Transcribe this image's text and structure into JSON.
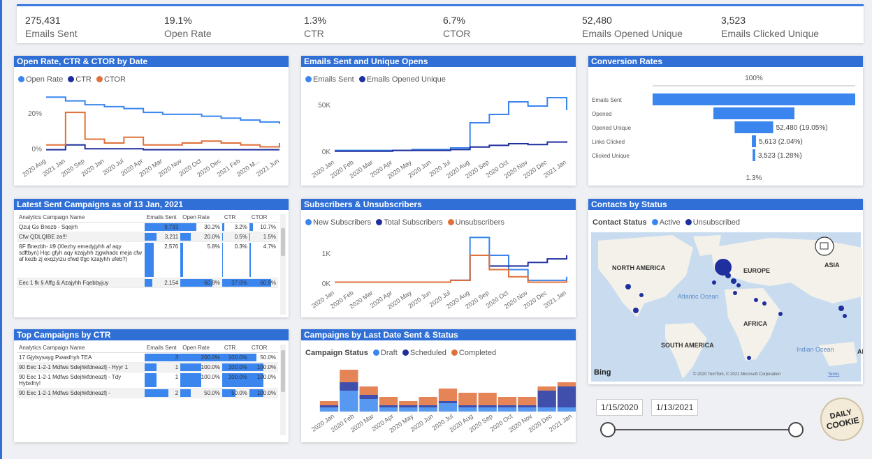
{
  "kpis": [
    {
      "value": "275,431",
      "label": "Emails Sent"
    },
    {
      "value": "19.1%",
      "label": "Open Rate"
    },
    {
      "value": "1.3%",
      "label": "CTR"
    },
    {
      "value": "6.7%",
      "label": "CTOR"
    },
    {
      "value": "52,480",
      "label": "Emails Opened Unique"
    },
    {
      "value": "3,523",
      "label": "Emails Clicked Unique"
    }
  ],
  "colors": {
    "accent": "#2f6fd6",
    "light_blue": "#3a86ee",
    "dark_blue": "#1f2f9e",
    "orange": "#e0703a"
  },
  "chart_data": [
    {
      "type": "line",
      "title": "Open Rate, CTR & CTOR by Date",
      "categories": [
        "2020 Aug",
        "2021 Jan",
        "2020 Sep",
        "2020 Jan",
        "2020 Jul",
        "2020 Apr",
        "2020 Mar",
        "2020 Nov",
        "2020 Oct",
        "2020 Dec",
        "2021 Feb",
        "2020 M...",
        "2021 Jun"
      ],
      "yticks": [
        "20%",
        "0%"
      ],
      "series": [
        {
          "name": "Open Rate",
          "values": [
            28,
            26,
            24,
            23,
            22,
            20,
            19,
            19,
            18,
            17,
            16,
            15,
            14
          ]
        },
        {
          "name": "CTR",
          "values": [
            0.5,
            3,
            1,
            1,
            1,
            0.5,
            0.5,
            0.5,
            0.5,
            0.5,
            0.5,
            0.5,
            0.5
          ]
        },
        {
          "name": "CTOR",
          "values": [
            3,
            20,
            6,
            4,
            7,
            3,
            3,
            4,
            5,
            4,
            3,
            2,
            4
          ]
        }
      ],
      "ylim": [
        0,
        35
      ]
    },
    {
      "type": "line",
      "title": "Emails Sent and Unique Opens",
      "categories": [
        "2020 Jan",
        "2020 Feb",
        "2020 Mar",
        "2020 Apr",
        "2020 May",
        "2020 Jun",
        "2020 Jul",
        "2020 Aug",
        "2020 Sep",
        "2020 Oct",
        "2020 Nov",
        "2020 Dec",
        "2021 Jan"
      ],
      "yticks": [
        "50K",
        "0K"
      ],
      "series": [
        {
          "name": "Emails Sent",
          "values": [
            2,
            2,
            2,
            2,
            3,
            3,
            5,
            35,
            45,
            60,
            55,
            65,
            50
          ]
        },
        {
          "name": "Emails Opened Unique",
          "values": [
            1,
            1,
            1,
            2,
            2,
            2,
            3,
            6,
            8,
            10,
            9,
            12,
            13
          ]
        }
      ],
      "ylim": [
        0,
        75
      ]
    },
    {
      "type": "bar",
      "title": "Conversion Rates",
      "categories": [
        "Emails Sent",
        "Opened",
        "Opened Unique",
        "Links Clicked",
        "Clicked Unique"
      ],
      "values": [
        100,
        40,
        19.05,
        2.04,
        1.28
      ],
      "labels": [
        "",
        "",
        "52,480 (19.05%)",
        "5,613 (2.04%)",
        "3,523 (1.28%)"
      ],
      "top_label": "100%",
      "bottom_label": "1.3%"
    },
    {
      "type": "line",
      "title": "Subscribers & Unsubscribers",
      "categories": [
        "2020 Jan",
        "2020 Feb",
        "2020 Mar",
        "2020 Apr",
        "2020 May",
        "2020 Jun",
        "2020 Jul",
        "2020 Aug",
        "2020 Sep",
        "2020 Oct",
        "2020 Nov",
        "2020 Dec",
        "2021 Jan"
      ],
      "yticks": [
        "1K",
        "0K"
      ],
      "series": [
        {
          "name": "New Subscribers",
          "values": [
            0.05,
            0.05,
            0.05,
            0.05,
            0.05,
            0.05,
            0.1,
            1.3,
            0.8,
            0.4,
            0.1,
            0.1,
            0.2
          ]
        },
        {
          "name": "Total Subscribers",
          "values": [
            0.05,
            0.05,
            0.05,
            0.05,
            0.05,
            0.05,
            0.1,
            0.8,
            0.5,
            0.5,
            0.6,
            0.7,
            0.8
          ]
        },
        {
          "name": "Unsubscribers",
          "values": [
            0.05,
            0.05,
            0.05,
            0.05,
            0.05,
            0.05,
            0.1,
            0.8,
            0.4,
            0.2,
            0.05,
            0.05,
            0.1
          ]
        }
      ],
      "ylim": [
        0,
        1.6
      ]
    },
    {
      "type": "area",
      "title": "Campaigns by Last Date Sent & Status",
      "categories": [
        "2020 Jan",
        "2020 Feb",
        "2020 Mar",
        "2020 Apr",
        "2020 May",
        "2020 Jun",
        "2020 Jul",
        "2020 Aug",
        "2020 Sep",
        "2020 Oct",
        "2020 Nov",
        "2020 Dec",
        "2021 Jan"
      ],
      "series": [
        {
          "name": "Draft",
          "values": [
            1,
            5,
            3,
            1,
            1,
            1,
            2,
            1,
            1,
            1,
            1,
            1,
            1
          ]
        },
        {
          "name": "Scheduled",
          "values": [
            0.5,
            2,
            1,
            0.5,
            0.5,
            0.5,
            0.5,
            0.5,
            0.5,
            0.5,
            0.5,
            4,
            5
          ]
        },
        {
          "name": "Completed",
          "values": [
            1,
            3,
            2,
            2,
            1,
            2,
            3,
            3,
            3,
            2,
            2,
            1,
            1
          ]
        }
      ]
    }
  ],
  "cards": {
    "open_rate": {
      "title": "Open Rate, CTR & CTOR by Date",
      "legend": [
        "Open Rate",
        "CTR",
        "CTOR"
      ]
    },
    "emails_sent": {
      "title": "Emails Sent and Unique Opens",
      "legend": [
        "Emails Sent",
        "Emails Opened Unique"
      ]
    },
    "conversion": {
      "title": "Conversion Rates"
    },
    "subscribers": {
      "title": "Subscribers & Unsubscribers",
      "legend": [
        "New Subscribers",
        "Total Subscribers",
        "Unsubscribers"
      ]
    },
    "campaigns_status": {
      "title": "Campaigns by Last Date Sent & Status",
      "legend_title": "Campaign Status",
      "legend": [
        "Draft",
        "Scheduled",
        "Completed"
      ]
    },
    "contacts": {
      "title": "Contacts by Status",
      "legend_title": "Contact Status",
      "legend": [
        "Active",
        "Unsubscribed"
      ]
    }
  },
  "latest_campaigns": {
    "title": "Latest Sent Campaigns as of 13 Jan, 2021",
    "columns": [
      "Analytics Campaign Name",
      "Emails Sent",
      "Open Rate",
      "CTR",
      "CTOR"
    ],
    "rows": [
      {
        "name": "Qzuj Gs Bnezb - Sqejrh",
        "sent": "9,733",
        "open": "30.2%",
        "ctr": "3.2%",
        "ctor": "10.7%",
        "sent_pct": 100,
        "open_pct": 38,
        "ctr_pct": 9,
        "ctor_pct": 12
      },
      {
        "name": "Cfw QDLQIBE za!!!",
        "sent": "3,211",
        "open": "20.0%",
        "ctr": "0.5%",
        "ctor": "1.5%",
        "sent_pct": 33,
        "open_pct": 25,
        "ctr_pct": 1,
        "ctor_pct": 2
      },
      {
        "name": "ßF Bnezbh- #9 (Xlezhy emedyjyhh af aqy sdftbyn) Hqc gfyh aqy kzajyhh zjgwhadc meja cfw af kezb zj exqzyizu cfwd tfgc kzajyhh ufeb?)",
        "sent": "2,576",
        "open": "5.8%",
        "ctr": "0.3%",
        "ctor": "4.7%",
        "sent_pct": 26,
        "open_pct": 7,
        "ctr_pct": 1,
        "ctor_pct": 6
      },
      {
        "name": "Eec 1 fk § Affg & Azajyhh Fqebbyjuy",
        "sent": "2,154",
        "open": "60.8%",
        "ctr": "37.0%",
        "ctor": "60.9%",
        "sent_pct": 22,
        "open_pct": 76,
        "ctr_pct": 100,
        "ctor_pct": 76
      }
    ]
  },
  "top_campaigns": {
    "title": "Top Campaigns by CTR",
    "columns": [
      "Analytics Campaign Name",
      "Emails Sent",
      "Open Rate",
      "CTR",
      "CTOR"
    ],
    "rows": [
      {
        "name": "17 Gjylsysayg Pwasfnyh TEA",
        "sent": "3",
        "open": "200.0%",
        "ctr": "100.0%",
        "ctor": "50.0%",
        "sent_pct": 100,
        "open_pct": 100,
        "ctr_pct": 100,
        "ctor_pct": 25
      },
      {
        "name": "90 Eec 1-2-1 Mdfws Sdejhkfdneazfj - Hyyr 1",
        "sent": "1",
        "open": "100.0%",
        "ctr": "100.0%",
        "ctor": "100.0%",
        "sent_pct": 33,
        "open_pct": 50,
        "ctr_pct": 100,
        "ctor_pct": 50
      },
      {
        "name": "90 Eec 1-2-1 Mdfws Sdejhkfdneazfj - Tdy Hybxfny!",
        "sent": "1",
        "open": "100.0%",
        "ctr": "100.0%",
        "ctor": "100.0%",
        "sent_pct": 33,
        "open_pct": 50,
        "ctr_pct": 100,
        "ctor_pct": 50
      },
      {
        "name": "90 Eec 1-2-1 Mdfws Sdejhkfdneazfj -",
        "sent": "2",
        "open": "50.0%",
        "ctr": "50.0%",
        "ctor": "100.0%",
        "sent_pct": 66,
        "open_pct": 25,
        "ctr_pct": 50,
        "ctor_pct": 50
      }
    ]
  },
  "map": {
    "labels": [
      "NORTH AMERICA",
      "EUROPE",
      "ASIA",
      "AFRICA",
      "SOUTH AMERICA",
      "Atlantic Ocean",
      "Indian Ocean"
    ],
    "bing": "Bing",
    "copyright": "© 2020 TomTom, © 2021 Microsoft Corporation",
    "terms": "Terms",
    "edge_label": "Al"
  },
  "date_range": {
    "start": "1/15/2020",
    "end": "1/13/2021"
  },
  "logo": {
    "line1": "DAILY",
    "line2": "COOKIE"
  }
}
